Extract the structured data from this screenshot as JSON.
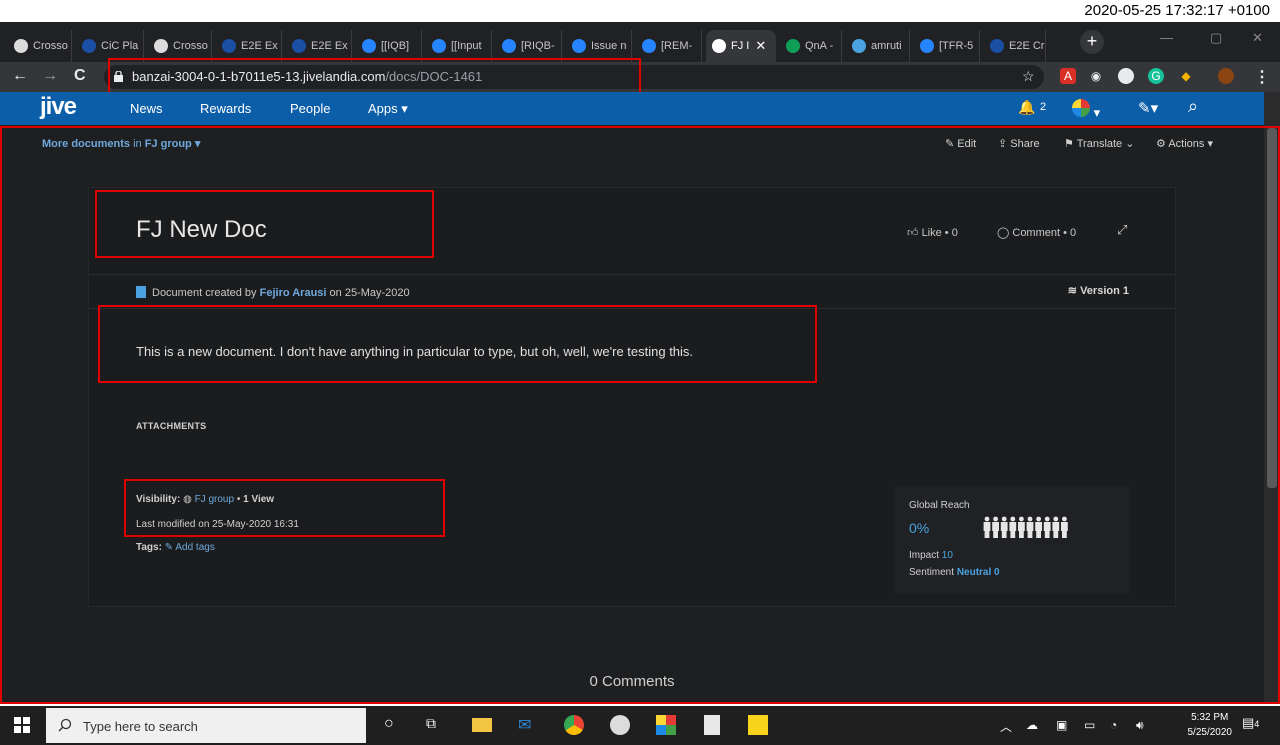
{
  "timestamp": "2020-05-25 17:32:17 +0100",
  "browser": {
    "tabs": [
      {
        "label": "Crosso",
        "color": "#dcdcdc"
      },
      {
        "label": "CiC Pla",
        "color": "#1b4fa3"
      },
      {
        "label": "Crosso",
        "color": "#dcdcdc"
      },
      {
        "label": "E2E Ex",
        "color": "#1b4fa3"
      },
      {
        "label": "E2E Ex",
        "color": "#1b4fa3"
      },
      {
        "label": "[[IQB]",
        "color": "#2684ff"
      },
      {
        "label": "[[Input",
        "color": "#2684ff"
      },
      {
        "label": "[RIQB-",
        "color": "#2684ff"
      },
      {
        "label": "Issue n",
        "color": "#2684ff"
      },
      {
        "label": "[REM-",
        "color": "#2684ff"
      },
      {
        "label": "FJ I",
        "color": "#ffffff"
      },
      {
        "label": "QnA -",
        "color": "#0f9d58"
      },
      {
        "label": "amruti",
        "color": "#4aa3df"
      },
      {
        "label": "[TFR-5",
        "color": "#2684ff"
      },
      {
        "label": "E2E Cr",
        "color": "#1b4fa3"
      }
    ],
    "new_tab": "+",
    "close_tab": "✕",
    "url_host": "banzai-3004-0-1-b7011e5-13.jivelandia.com",
    "url_path": "/docs/DOC-1461"
  },
  "jive": {
    "logo": "jive",
    "nav": [
      "News",
      "Rewards",
      "People",
      "Apps"
    ],
    "notifications": "2"
  },
  "page": {
    "more_docs": "More documents",
    "more_docs_in": "in",
    "group": "FJ group",
    "actions": [
      "Edit",
      "Share",
      "Translate",
      "Actions"
    ],
    "title": "FJ New Doc",
    "like_label": "Like",
    "like_count": "0",
    "comment_label": "Comment",
    "comment_count": "0",
    "created_prefix": "Document created by",
    "author": "Fejiro Arausi",
    "created_on": "on 25-May-2020",
    "version": "Version 1",
    "body": "This is a new document. I don't have anything in particular to type, but oh, well, we're testing this.",
    "attachments_heading": "ATTACHMENTS",
    "visibility_label": "Visibility:",
    "visibility_group": "FJ group",
    "views": "1 View",
    "last_modified": "Last modified on 25-May-2020 16:31",
    "tags_label": "Tags:",
    "add_tags": "Add tags",
    "reach_title": "Global Reach",
    "reach_percent": "0%",
    "impact_label": "Impact",
    "impact_value": "10",
    "sentiment_label": "Sentiment",
    "sentiment_value": "Neutral 0",
    "comments_count": "0 Comments"
  },
  "taskbar": {
    "search_placeholder": "Type here to search",
    "time": "5:32 PM",
    "date": "5/25/2020",
    "notif_count": "4"
  }
}
